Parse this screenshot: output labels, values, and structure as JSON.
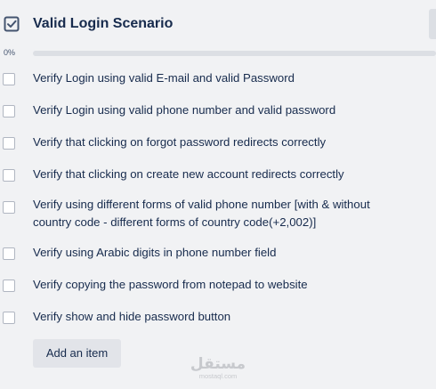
{
  "checklist": {
    "title": "Valid Login Scenario",
    "progress_label": "0%",
    "progress_fraction": 0,
    "items": [
      {
        "text": "Verify Login using valid E-mail and valid Password",
        "checked": false
      },
      {
        "text": "Verify Login using valid phone number and valid password",
        "checked": false
      },
      {
        "text": "Verify that clicking on forgot password redirects correctly",
        "checked": false
      },
      {
        "text": "Verify that clicking on create new account redirects correctly",
        "checked": false
      },
      {
        "text": "Verify using different forms of valid phone number [with & without country code - different forms of country code(+2,002)]",
        "checked": false
      },
      {
        "text": "Verify using Arabic digits in phone number field",
        "checked": false
      },
      {
        "text": "Verify copying the password from notepad to website",
        "checked": false
      },
      {
        "text": "Verify show and hide password button",
        "checked": false
      }
    ],
    "add_item_label": "Add an item"
  },
  "icons": {
    "header": "checked-box-icon"
  },
  "colors": {
    "background": "#f1f2f4",
    "text": "#172b4d",
    "progress_track": "#dcdfe4",
    "button_bg": "#e2e4e9",
    "checkbox_border": "#b0b6c1"
  },
  "watermark": {
    "logo_text": "مستقل",
    "url_text": "mostaql.com"
  }
}
